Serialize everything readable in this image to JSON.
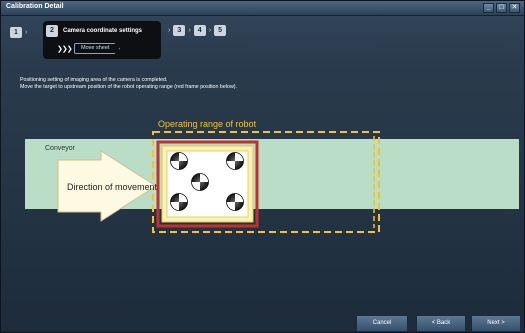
{
  "window": {
    "title": "Calibration Detail",
    "controls": {
      "minimize": "_",
      "maximize": "□",
      "close": "✕"
    }
  },
  "steps": {
    "items": [
      {
        "num": "1"
      },
      {
        "num": "2",
        "label": "Camera coordinate settings",
        "active": true
      },
      {
        "num": "3"
      },
      {
        "num": "4"
      },
      {
        "num": "5"
      }
    ],
    "arrow_glyph": "›",
    "substep_chevrons": "❯❯❯",
    "substep_label": "Move sheet"
  },
  "instructions": {
    "line1": "Positioning setting of imaging area of the camera is completed.",
    "line2": "Move the target to upstream position of the robot operating range (red frame position below)."
  },
  "diagram": {
    "operating_range_label": "Operating range of robot",
    "conveyor_label": "Conveyor",
    "direction_label": "Direction of movement",
    "target_marks": 5,
    "colors": {
      "conveyor": "#b9ddc6",
      "operating_range": "#f2c230",
      "frame": "#c5302a",
      "sheet": "#f7f3b4"
    }
  },
  "buttons": {
    "cancel": "Cancel",
    "back": "< Back",
    "next": "Next >"
  }
}
